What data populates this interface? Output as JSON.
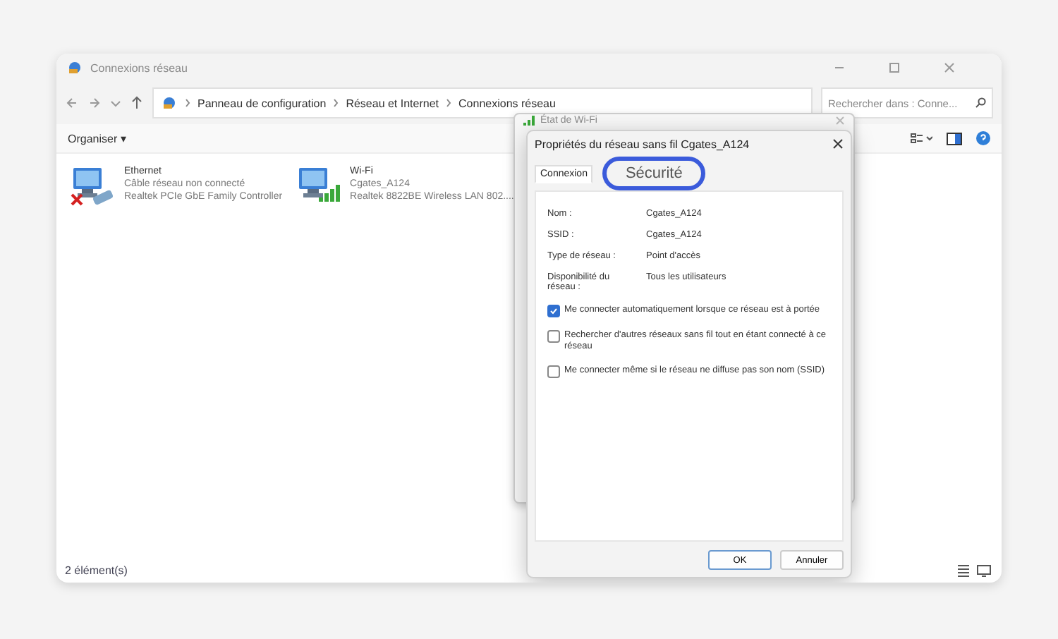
{
  "window": {
    "title": "Connexions réseau"
  },
  "address_bar": {
    "crumbs": [
      "Panneau de configuration",
      "Réseau et Internet",
      "Connexions réseau"
    ]
  },
  "search": {
    "placeholder": "Rechercher dans : Conne..."
  },
  "toolbar": {
    "organize": "Organiser ▾"
  },
  "connections": [
    {
      "kind": "wired",
      "name": "Ethernet",
      "status": "Câble réseau non connecté",
      "adapter": "Realtek PCIe GbE Family Controller",
      "connected": false
    },
    {
      "kind": "wifi",
      "name": "Wi-Fi",
      "status": "Cgates_A124",
      "adapter": "Realtek 8822BE Wireless LAN 802....",
      "connected": true
    }
  ],
  "status_bar": {
    "count": "2 élément(s)"
  },
  "status_window": {
    "title": "État de Wi-Fi"
  },
  "dialog": {
    "title": "Propriétés du réseau sans fil Cgates_A124",
    "tabs": [
      {
        "label": "Connexion",
        "selected": true,
        "highlighted": false
      },
      {
        "label": "Sécurité",
        "selected": false,
        "highlighted": true
      }
    ],
    "fields": [
      {
        "label": "Nom :",
        "value": "Cgates_A124"
      },
      {
        "label": "SSID :",
        "value": "Cgates_A124"
      },
      {
        "label": "Type de réseau :",
        "value": "Point d'accès"
      },
      {
        "label": "Disponibilité du réseau :",
        "value": "Tous les utilisateurs"
      }
    ],
    "options": [
      {
        "label": "Me connecter automatiquement lorsque ce réseau est à portée",
        "checked": true
      },
      {
        "label": "Rechercher d'autres réseaux sans fil tout en étant connecté à ce réseau",
        "checked": false
      },
      {
        "label": "Me connecter même si le réseau ne diffuse pas son nom (SSID)",
        "checked": false
      }
    ],
    "buttons": [
      {
        "label": "OK",
        "default": true
      },
      {
        "label": "Annuler",
        "default": false
      }
    ]
  }
}
